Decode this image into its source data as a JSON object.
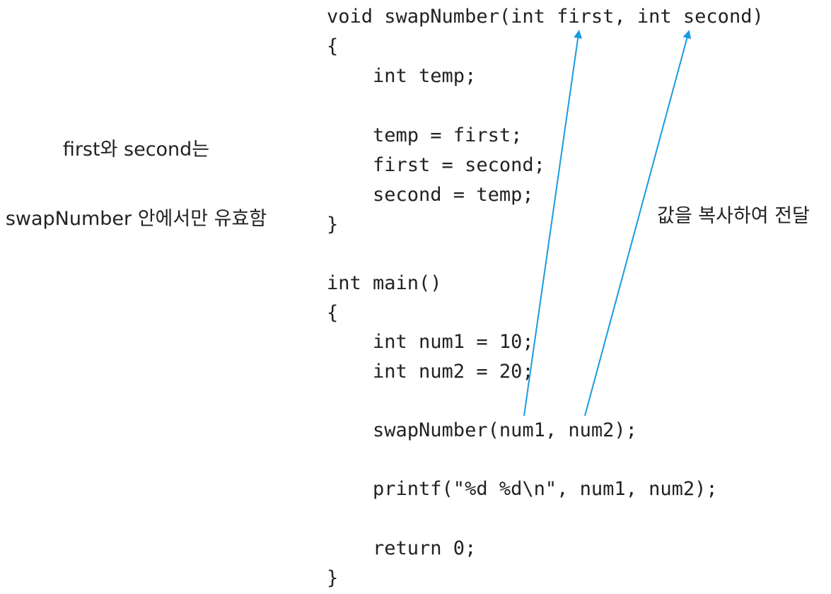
{
  "code_lines": [
    "void swapNumber(int first, int second)",
    "{",
    "    int temp;",
    "",
    "    temp = first;",
    "    first = second;",
    "    second = temp;",
    "}",
    "",
    "int main()",
    "{",
    "    int num1 = 10;",
    "    int num2 = 20;",
    "",
    "    swapNumber(num1, num2);",
    "",
    "    printf(\"%d %d\\n\", num1, num2);",
    "",
    "    return 0;",
    "}"
  ],
  "annotations": {
    "scope_note_line1": "first와 second는",
    "scope_note_line2": "swapNumber 안에서만 유효함",
    "copy_note": "값을 복사하여 전달"
  },
  "colors": {
    "arrow": "#1a9be0",
    "text": "#222222",
    "background": "#ffffff"
  }
}
